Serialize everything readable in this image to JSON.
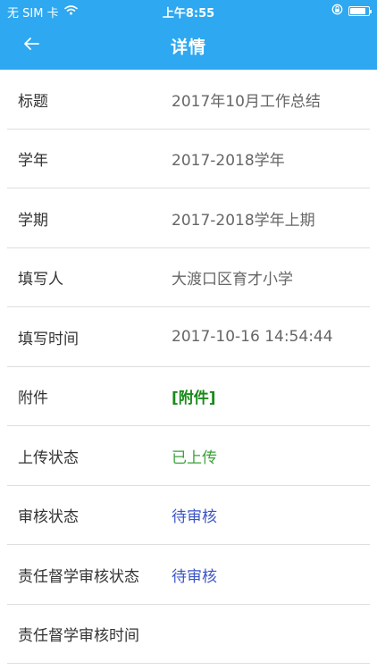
{
  "status_bar": {
    "carrier": "无 SIM 卡",
    "time": "上午8:55",
    "battery_level": 0.85
  },
  "nav": {
    "back_icon": "arrow-left-icon",
    "title": "详情"
  },
  "rows": [
    {
      "label": "标题",
      "value": "2017年10月工作总结"
    },
    {
      "label": "学年",
      "value": "2017-2018学年"
    },
    {
      "label": "学期",
      "value": "2017-2018学年上期"
    },
    {
      "label": "填写人",
      "value": "大渡口区育才小学"
    },
    {
      "label": "填写时间",
      "value": "2017-10-16 14:54:44"
    },
    {
      "label": "附件",
      "value": "[附件]"
    },
    {
      "label": "上传状态",
      "value": "已上传"
    },
    {
      "label": "审核状态",
      "value": "待审核"
    },
    {
      "label": "责任督学审核状态",
      "value": "待审核"
    },
    {
      "label": "责任督学审核时间",
      "value": ""
    }
  ],
  "colors": {
    "header": "#2ea8f0",
    "uploaded": "#3aa33a",
    "pending": "#3c55c6",
    "attachment": "#1a8a1a"
  }
}
